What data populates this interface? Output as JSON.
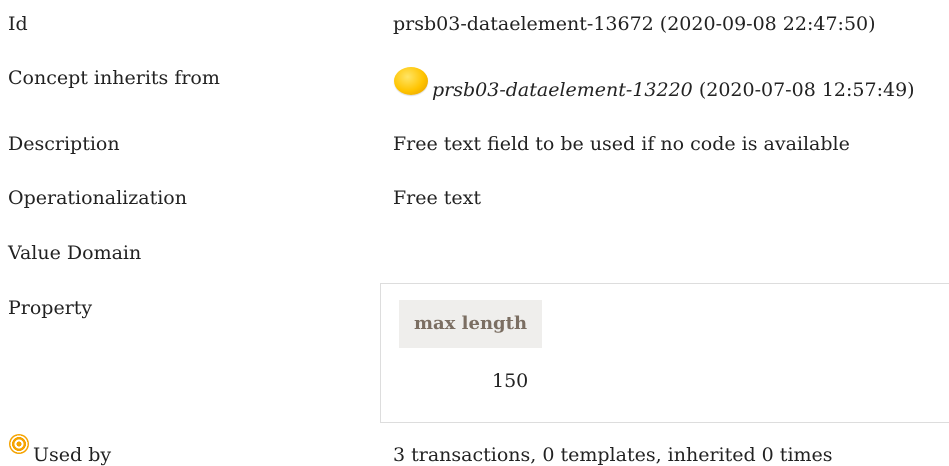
{
  "rows": {
    "id": {
      "label": "Id",
      "value": "prsb03-dataelement-13672 (2020-09-08 22:47:50)"
    },
    "inherits": {
      "label": "Concept inherits from",
      "link": "prsb03-dataelement-13220",
      "date": " (2020-07-08 12:57:49)",
      "icon": "yellow-orb-icon"
    },
    "description": {
      "label": "Description",
      "value": "Free text field to be used if no code is available"
    },
    "operationalization": {
      "label": "Operationalization",
      "value": "Free text"
    },
    "value_domain": {
      "label": "Value Domain"
    },
    "property": {
      "label": "Property",
      "column_header": "max length",
      "cell_value": "150"
    },
    "used_by": {
      "label": "Used by",
      "value": "3 transactions, 0 templates, inherited 0 times",
      "icon": "target-icon"
    }
  }
}
